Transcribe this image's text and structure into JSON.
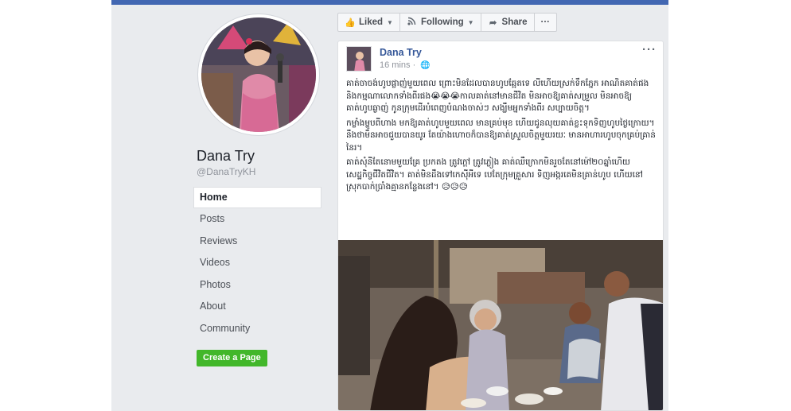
{
  "sidebar": {
    "page_name": "Dana Try",
    "handle": "@DanaTryKH",
    "nav": [
      {
        "label": "Home",
        "active": true
      },
      {
        "label": "Posts",
        "active": false
      },
      {
        "label": "Reviews",
        "active": false
      },
      {
        "label": "Videos",
        "active": false
      },
      {
        "label": "Photos",
        "active": false
      },
      {
        "label": "About",
        "active": false
      },
      {
        "label": "Community",
        "active": false
      }
    ],
    "create_button": "Create a Page"
  },
  "actions": {
    "liked": "Liked",
    "following": "Following",
    "share": "Share",
    "more": "···"
  },
  "post": {
    "author": "Dana Try",
    "time": "16 mins",
    "more": "···",
    "paragraphs": [
      "គាត់ចាចង់ហូបផ្លាញ់មួយពេល ព្រោះមិនដែលបានហូបឆ្អែតទេ លីហើយស្រក់ទឹកភ្នែក អាណិតគាត់ផង និងកម្មណាលោកទាំងពីរផង😭😭😭កាលគាត់នៅមានជីវិត មិនអាចឱ្យគាត់សម្រួល មិនអាចឱ្យគាត់ហូបឆ្ងាញ់ កូនក្រុមដើរបំពេញបំណងចាស់ៗ សង្ឃឹមអ្នកទាំងពីរ សប្បាយចិត្ត។",
      "កម្លាំងម្ហូបពីហាង មកឱ្យគាត់ហូបមួយពេល មានគ្រប់មុខ ហើយជូនលុយគាត់ខ្លះទុកទិញហូបថ្ងៃក្រោយ។ នឹងថាមិនអាចជួយបានយូរ តែយ៉ាងហោចក៏បានឱ្យគាត់ស្រួលចិត្តមួយរយៈ មានអាហារហូបចុកគ្រប់គ្រាន់នៃរ។",
      "គាត់សុំនីតែនោមមួយគ្រែ ប្រកតង ត្រូវក្តៅ ត្រូវភ្លៀង គាត់ឈឺក្រោកមិនរួចតែនៅម៉ៅ២០ឆ្នាំហើយ សេដ្ឋកិច្ចជីវិតជីវិត។ គាត់មិនដឹងទៅកេស៊ីអីទេ បេតែក្រុមគ្រួសារ ទិញអង្ករគេមិនគ្រាន់ហូប ហើយនៅស្រុកបាក់ប្រាំងគ្មានកន្លែងនៅ។ 😥😥😥"
    ]
  },
  "colors": {
    "brand": "#4267b2",
    "link": "#365899",
    "create_green": "#42b72a",
    "sidebar_bg": "#e9ebee"
  },
  "icons": [
    "thumbs-up-icon",
    "rss-icon",
    "share-arrow-icon",
    "globe-icon",
    "caret-down-icon"
  ]
}
